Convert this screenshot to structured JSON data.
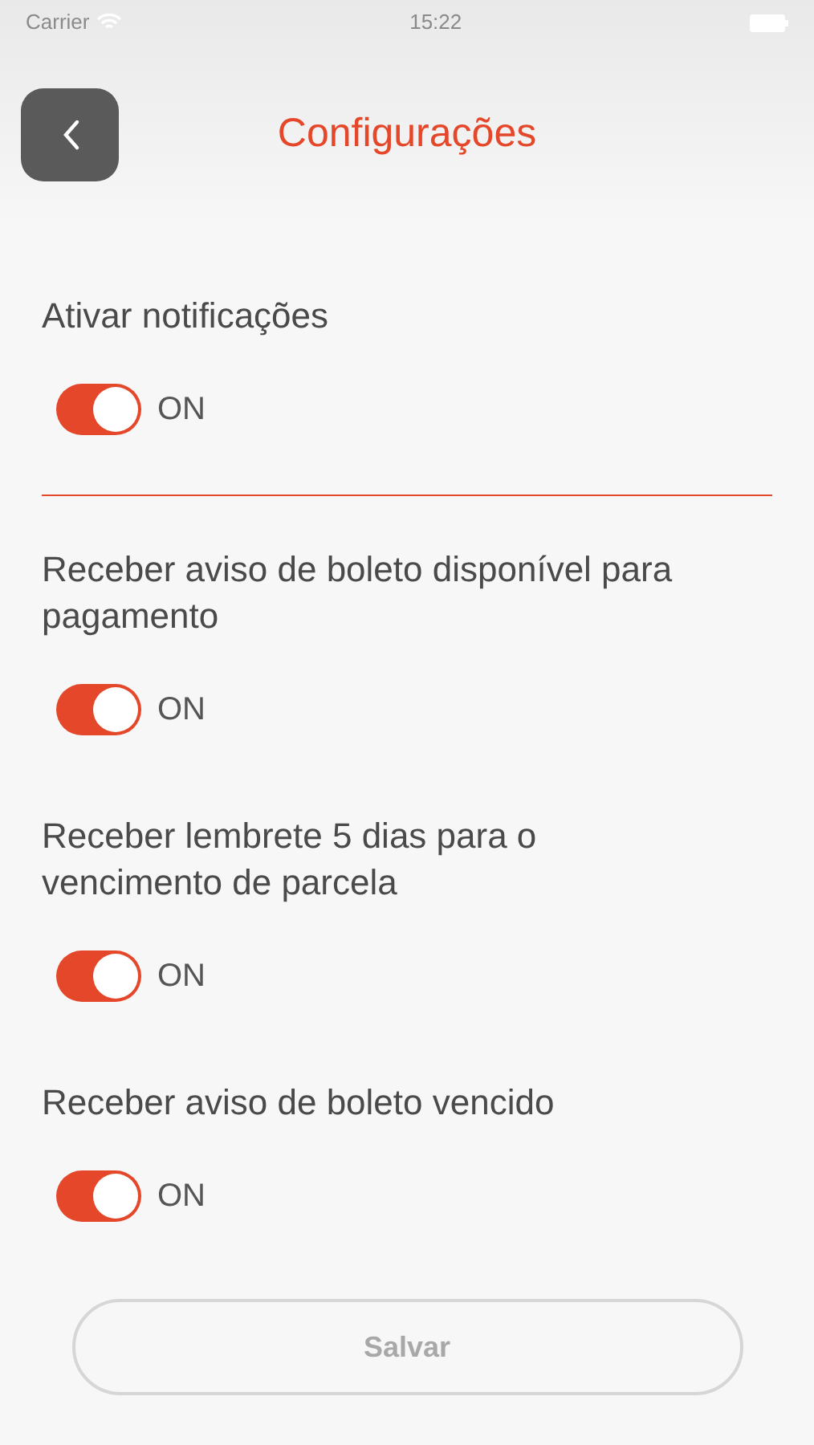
{
  "status_bar": {
    "carrier": "Carrier",
    "time": "15:22"
  },
  "header": {
    "title": "Configurações"
  },
  "sections": [
    {
      "settings": [
        {
          "label": "Ativar notificações",
          "on": true,
          "state_label": "ON"
        }
      ]
    },
    {
      "settings": [
        {
          "label": "Receber aviso de boleto disponível para pagamento",
          "on": true,
          "state_label": "ON"
        },
        {
          "label": "Receber lembrete 5 dias para o vencimento de parcela",
          "on": true,
          "state_label": "ON"
        },
        {
          "label": "Receber aviso de boleto vencido",
          "on": true,
          "state_label": "ON"
        }
      ]
    }
  ],
  "save_button": {
    "label": "Salvar",
    "disabled": true
  }
}
